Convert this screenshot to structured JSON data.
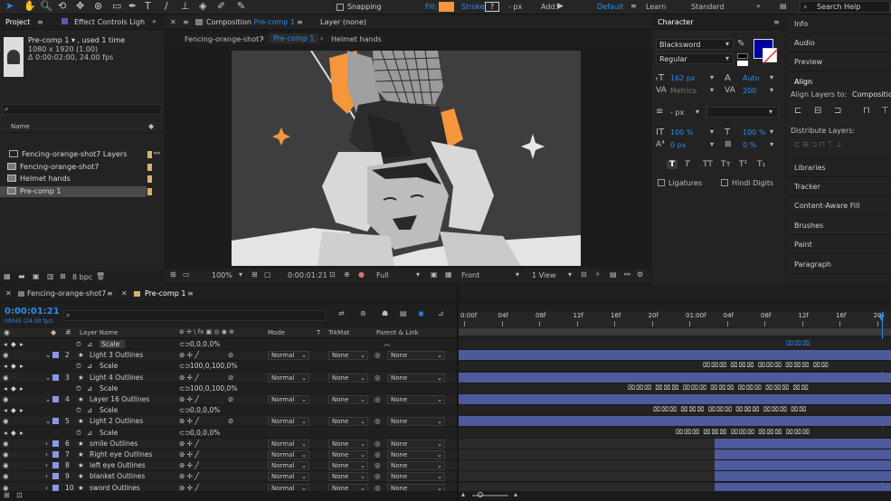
{
  "toolbar": {
    "snapping": "Snapping",
    "fill": "Fill:",
    "stroke": "Stroke:",
    "stroke_px": "- px",
    "add": "Add:",
    "workspaces": [
      "Default",
      "Learn",
      "Standard"
    ],
    "search": "Search Help"
  },
  "project": {
    "tabs": [
      "Project",
      "Effect Controls Ligh"
    ],
    "selected_name": "Pre-comp 1 ▾ , used 1 time",
    "dims": "1080 x 1920 (1.00)",
    "duration": "Δ 0:00:02:00, 24.00 fps",
    "search_placeholder": "",
    "col_name": "Name",
    "items": [
      "Fencing-orange-shot7 Layers",
      "Fencing-orange-shot7",
      "Helmet hands",
      "Pre-comp 1"
    ],
    "bpc": "8 bpc"
  },
  "comp": {
    "tab_label": "Composition",
    "tab_name": "Pre-comp 1",
    "layer_tab": "Layer (none)",
    "breadcrumb": [
      "Fencing-orange-shot7",
      "Pre-comp 1",
      "Helmet hands"
    ],
    "zoom": "100%",
    "time": "0:00:01:21",
    "resolution": "Full",
    "view": "Front",
    "views": "1 View"
  },
  "character": {
    "title": "Character",
    "font": "Blacksword",
    "style": "Regular",
    "size": "162 px",
    "leading": "Auto",
    "kerning": "Metrics",
    "tracking": "200",
    "stroke_width": "- px",
    "vscale": "100 %",
    "hscale": "100 %",
    "baseline": "0 px",
    "tsume": "0 %",
    "ligatures": "Ligatures",
    "hindi": "Hindi Digits",
    "fill_color": "#0000a0",
    "stroke_color": "#ffffff",
    "styles": [
      "T",
      "T",
      "TT",
      "Tт",
      "T¹",
      "T₁"
    ]
  },
  "right_panel": {
    "items": [
      "Info",
      "Audio",
      "Preview",
      "Align",
      "Libraries",
      "Tracker",
      "Content-Aware Fill",
      "Brushes",
      "Paint",
      "Paragraph"
    ],
    "align_to_label": "Align Layers to:",
    "align_to_value": "Composition",
    "distribute": "Distribute Layers:"
  },
  "timeline": {
    "tabs": [
      "Fencing-orange-shot7",
      "Pre-comp 1"
    ],
    "timecode": "0:00:01:21",
    "frames": "00045 (24.00 fps)",
    "headers": {
      "layer_name": "Layer Name",
      "mode": "Mode",
      "t": "T",
      "trkmat": "TrkMat",
      "parent": "Parent & Link"
    },
    "ruler": [
      "0:00f",
      "04f",
      "08f",
      "12f",
      "16f",
      "20f",
      "01:00f",
      "04f",
      "08f",
      "12f",
      "16f",
      "20f"
    ],
    "rows": [
      {
        "type": "prop",
        "name": "Scale",
        "value": "0,0,0,0%"
      },
      {
        "type": "layer",
        "num": "2",
        "name": "Light 3 Outlines",
        "mode": "Normal",
        "trk": "None",
        "parent": "None",
        "color": "#8d96e6"
      },
      {
        "type": "prop",
        "name": "Scale",
        "value": "100,0,100,0%"
      },
      {
        "type": "layer",
        "num": "3",
        "name": "Light 4 Outlines",
        "mode": "Normal",
        "trk": "None",
        "parent": "None",
        "color": "#8d96e6"
      },
      {
        "type": "prop",
        "name": "Scale",
        "value": "100,0,100,0%"
      },
      {
        "type": "layer",
        "num": "4",
        "name": "Layer 16 Outlines",
        "mode": "Normal",
        "trk": "None",
        "parent": "None",
        "color": "#8d96e6"
      },
      {
        "type": "prop",
        "name": "Scale",
        "value": "0,0,0,0%"
      },
      {
        "type": "layer",
        "num": "5",
        "name": "Light 2 Outlines",
        "mode": "Normal",
        "trk": "None",
        "parent": "None",
        "color": "#8d96e6"
      },
      {
        "type": "prop",
        "name": "Scale",
        "value": "0,0,0,0%"
      },
      {
        "type": "layer",
        "num": "6",
        "name": "smile Outlines",
        "mode": "Normal",
        "trk": "None",
        "parent": "None",
        "color": "#8d96e6"
      },
      {
        "type": "layer",
        "num": "7",
        "name": "Right eye Outlines",
        "mode": "Normal",
        "trk": "None",
        "parent": "None",
        "color": "#8d96e6"
      },
      {
        "type": "layer",
        "num": "8",
        "name": "left eye Outlines",
        "mode": "Normal",
        "trk": "None",
        "parent": "None",
        "color": "#8d96e6"
      },
      {
        "type": "layer",
        "num": "9",
        "name": "blanket Outlines",
        "mode": "Normal",
        "trk": "None",
        "parent": "None",
        "color": "#8d96e6"
      },
      {
        "type": "layer",
        "num": "10",
        "name": "sword Outlines",
        "mode": "Normal",
        "trk": "None",
        "parent": "None",
        "color": "#8d96e6"
      }
    ]
  }
}
